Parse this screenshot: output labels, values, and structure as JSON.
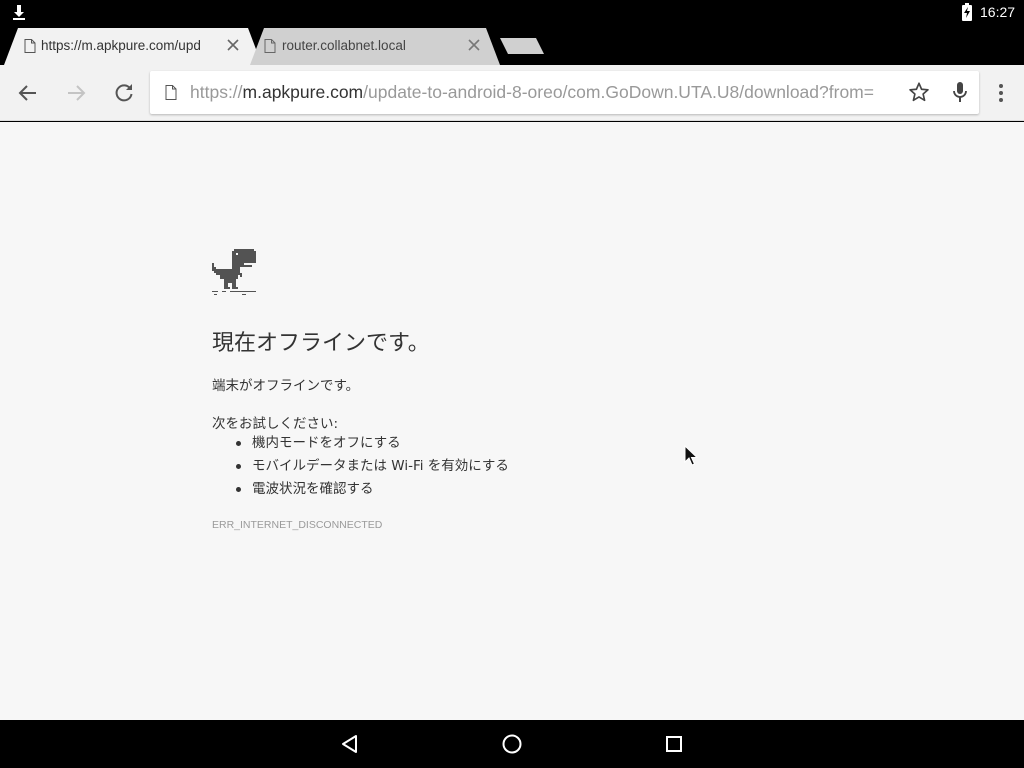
{
  "statusbar": {
    "time": "16:27",
    "icons": [
      "download-icon",
      "battery-charging-icon"
    ]
  },
  "tabs": [
    {
      "title": "https://m.apkpure.com/upd",
      "active": true,
      "favicon": "page-icon"
    },
    {
      "title": "router.collabnet.local",
      "active": false,
      "favicon": "page-icon"
    }
  ],
  "toolbar": {
    "url_scheme": "https://",
    "url_host": "m.apkpure.com",
    "url_path": "/update-to-android-8-oreo/com.GoDown.UTA.U8/download?from=",
    "icons": [
      "back-arrow-icon",
      "forward-arrow-icon",
      "reload-icon",
      "page-icon",
      "star-icon",
      "mic-icon",
      "overflow-menu-icon"
    ]
  },
  "error_page": {
    "heading": "現在オフラインです。",
    "subtext": "端末がオフラインです。",
    "try_label": "次をお試しください:",
    "suggestions": [
      "機内モードをオフにする",
      "モバイルデータまたは Wi-Fi を有効にする",
      "電波状況を確認する"
    ],
    "error_code": "ERR_INTERNET_DISCONNECTED"
  },
  "navbar": {
    "icons": [
      "back-triangle-icon",
      "home-circle-icon",
      "recents-square-icon"
    ]
  },
  "colors": {
    "page_bg": "#f7f7f7",
    "toolbar_bg": "#f2f2f2",
    "active_tab_bg": "#f2f2f2",
    "inactive_tab_bg": "#d0d0d0",
    "text": "#333333",
    "muted": "#9a9a9a"
  }
}
